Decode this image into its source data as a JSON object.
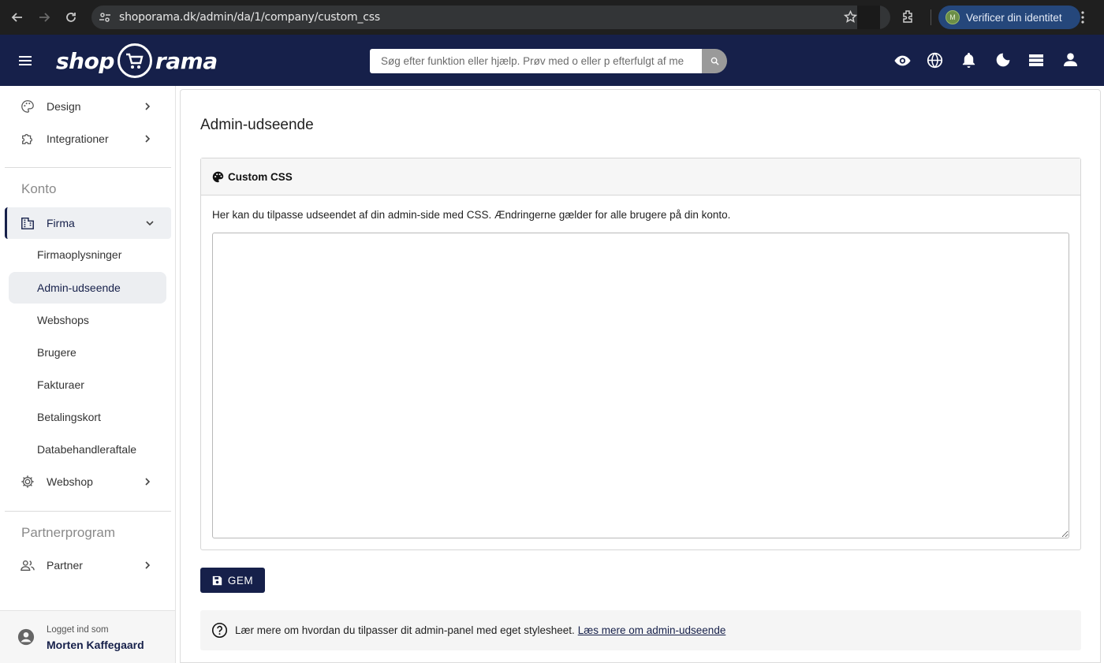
{
  "browser": {
    "url": "shoporama.dk/admin/da/1/company/custom_css",
    "profile_initial": "M",
    "verify_label": "Verificer din identitet"
  },
  "header": {
    "logo_left": "shop",
    "logo_right": "rama",
    "search_placeholder": "Søg efter funktion eller hjælp. Prøv med o eller p efterfulgt af me"
  },
  "sidebar": {
    "items_top": [
      {
        "label": "Design",
        "icon": "palette-icon"
      },
      {
        "label": "Integrationer",
        "icon": "puzzle-icon"
      }
    ],
    "section_account": "Konto",
    "firma_label": "Firma",
    "firma_sub": [
      "Firmaoplysninger",
      "Admin-udseende",
      "Webshops",
      "Brugere",
      "Fakturaer",
      "Betalingskort",
      "Databehandleraftale"
    ],
    "webshop_label": "Webshop",
    "section_partner": "Partnerprogram",
    "partner_label": "Partner",
    "logged_in_as": "Logget ind som",
    "user_name": "Morten Kaffegaard"
  },
  "main": {
    "title": "Admin-udseende",
    "card_title": "Custom CSS",
    "description": "Her kan du tilpasse udseendet af din admin-side med CSS. Ændringerne gælder for alle brugere på din konto.",
    "css_value": "",
    "save_label": "GEM",
    "help_text": "Lær mere om hvordan du tilpasser dit admin-panel med eget stylesheet.",
    "help_link": "Læs mere om admin-udseende"
  }
}
